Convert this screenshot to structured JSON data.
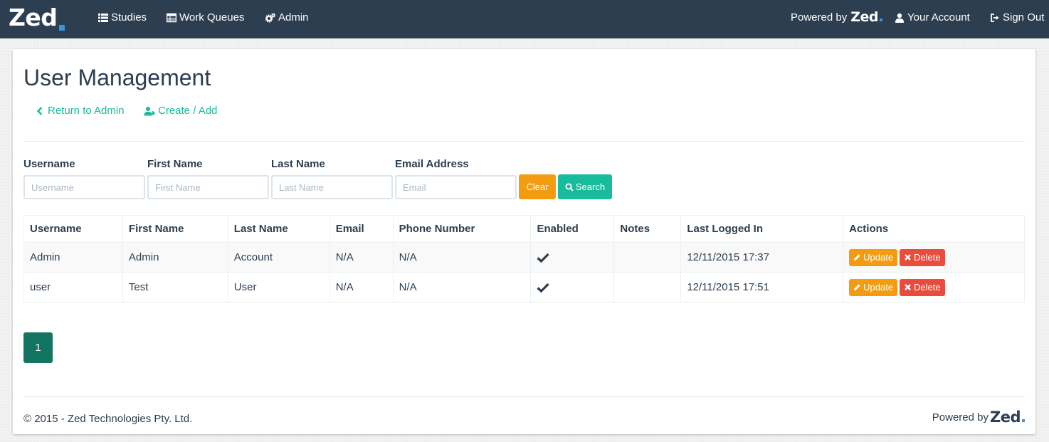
{
  "navbar": {
    "brand": "Zed",
    "items": [
      {
        "label": "Studies",
        "icon": "list-icon"
      },
      {
        "label": "Work Queues",
        "icon": "table-icon"
      },
      {
        "label": "Admin",
        "icon": "cogs-icon"
      }
    ],
    "powered_by_label": "Powered by",
    "powered_by_brand": "Zed",
    "account_label": "Your Account",
    "sign_out_label": "Sign Out"
  },
  "page": {
    "title": "User Management",
    "return_link": "Return to Admin",
    "create_link": "Create / Add"
  },
  "search": {
    "username_label": "Username",
    "username_placeholder": "Username",
    "first_name_label": "First Name",
    "first_name_placeholder": "First Name",
    "last_name_label": "Last Name",
    "last_name_placeholder": "Last Name",
    "email_label": "Email Address",
    "email_placeholder": "Email",
    "clear_label": "Clear",
    "search_label": "Search"
  },
  "table": {
    "headers": [
      "Username",
      "First Name",
      "Last Name",
      "Email",
      "Phone Number",
      "Enabled",
      "Notes",
      "Last Logged In",
      "Actions"
    ],
    "rows": [
      {
        "username": "Admin",
        "first_name": "Admin",
        "last_name": "Account",
        "email": "N/A",
        "phone": "N/A",
        "enabled": true,
        "notes": "",
        "last_logged_in": "12/11/2015 17:37"
      },
      {
        "username": "user",
        "first_name": "Test",
        "last_name": "User",
        "email": "N/A",
        "phone": "N/A",
        "enabled": true,
        "notes": "",
        "last_logged_in": "12/11/2015 17:51"
      }
    ],
    "update_label": "Update",
    "delete_label": "Delete"
  },
  "pagination": {
    "current_page": "1"
  },
  "footer": {
    "copyright": "© 2015 - Zed Technologies Pty. Ltd.",
    "powered_by_label": "Powered by",
    "powered_by_brand": "Zed"
  },
  "colors": {
    "navbar": "#2c3e50",
    "accent": "#18bc9c",
    "warning": "#f39c12",
    "danger": "#e74c3c",
    "brand_dot": "#3498db"
  }
}
